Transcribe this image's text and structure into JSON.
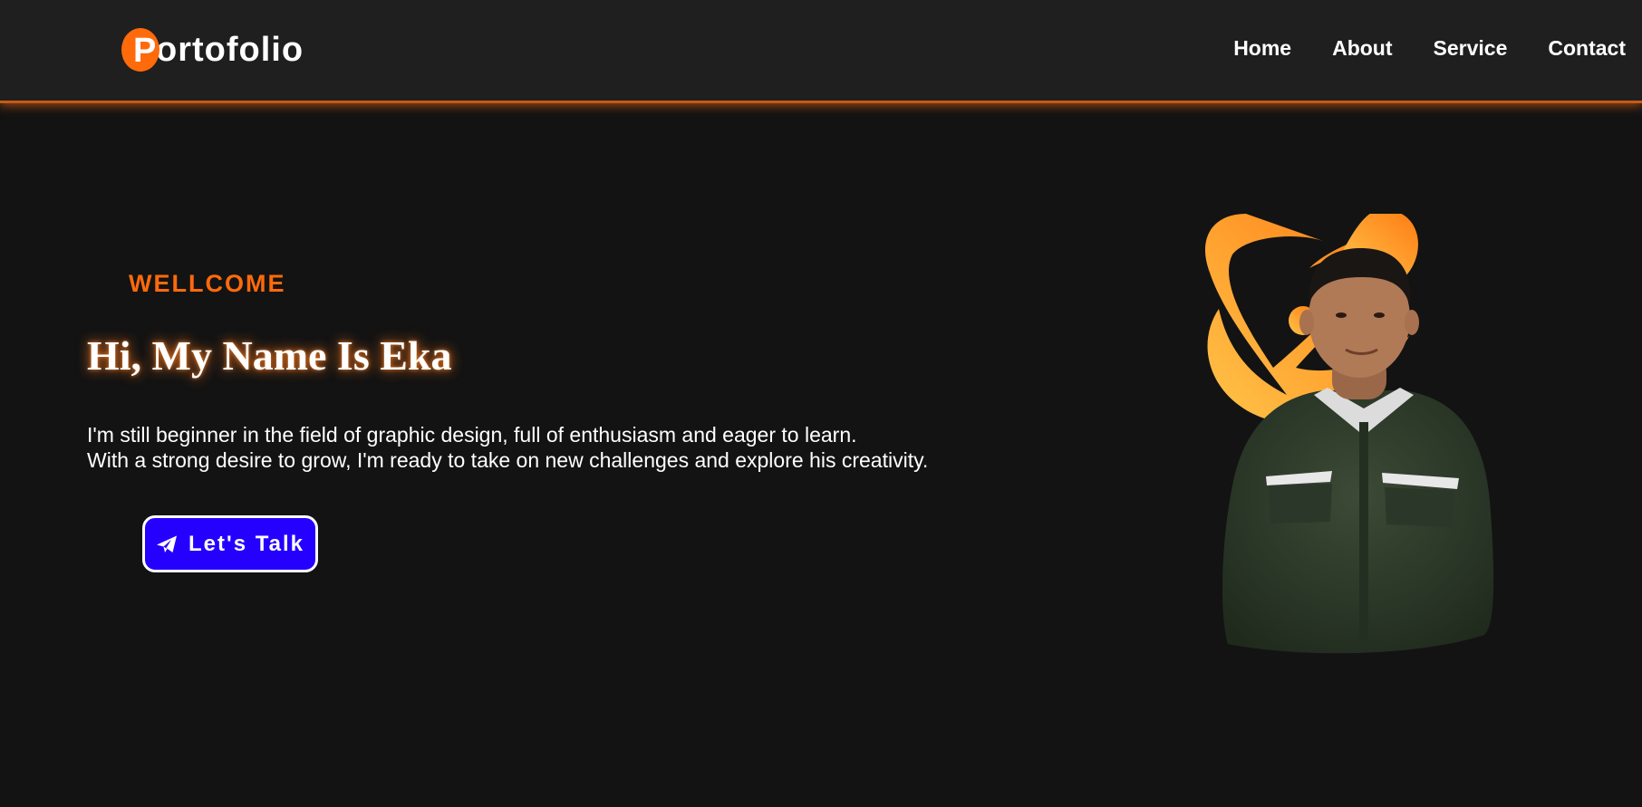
{
  "header": {
    "logo": {
      "initial": "P",
      "rest": "ortofolio"
    },
    "nav": [
      {
        "label": "Home"
      },
      {
        "label": "About"
      },
      {
        "label": "Service"
      },
      {
        "label": "Contact"
      }
    ]
  },
  "hero": {
    "eyebrow": "WELLCOME",
    "title": "Hi, My Name Is Eka",
    "description": [
      "I'm still beginner in the field of graphic design, full of enthusiasm and eager to learn.",
      "With a strong desire to grow, I'm ready to take on new challenges and explore his creativity."
    ],
    "cta": {
      "label": "Let's Talk",
      "icon": "paper-plane-icon"
    }
  },
  "colors": {
    "background": "#131313",
    "header": "#1f1f1f",
    "accent": "#ff6a0b",
    "button": "#2500ff"
  }
}
